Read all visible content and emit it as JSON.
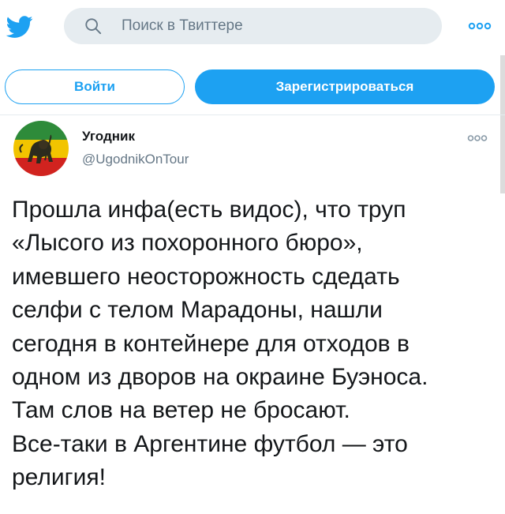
{
  "header": {
    "search_placeholder": "Поиск в Твиттере"
  },
  "auth": {
    "login_label": "Войти",
    "signup_label": "Зарегистрироваться"
  },
  "tweet": {
    "author_name": "Угодник",
    "author_handle": "@UgodnikOnTour",
    "lines": [
      "Прошла инфа(есть видос), что труп",
      "«Лысого из похоронного бюро»,",
      "имевшего неосторожность сдедать",
      "селфи с телом Марадоны, нашли",
      "сегодня в контейнере для отходов в",
      "одном из дворов на окраине Буэноса.",
      "Там слов на ветер не бросают.",
      "Все-таки в Аргентине футбол — это",
      "религия!"
    ]
  },
  "colors": {
    "accent": "#1da1f2",
    "search_bg": "#e6ecf0",
    "muted_text": "#657786",
    "text": "#14171a"
  },
  "icons": {
    "logo": "twitter-bird-icon",
    "search": "search-icon",
    "more": "more-dots-icon"
  }
}
